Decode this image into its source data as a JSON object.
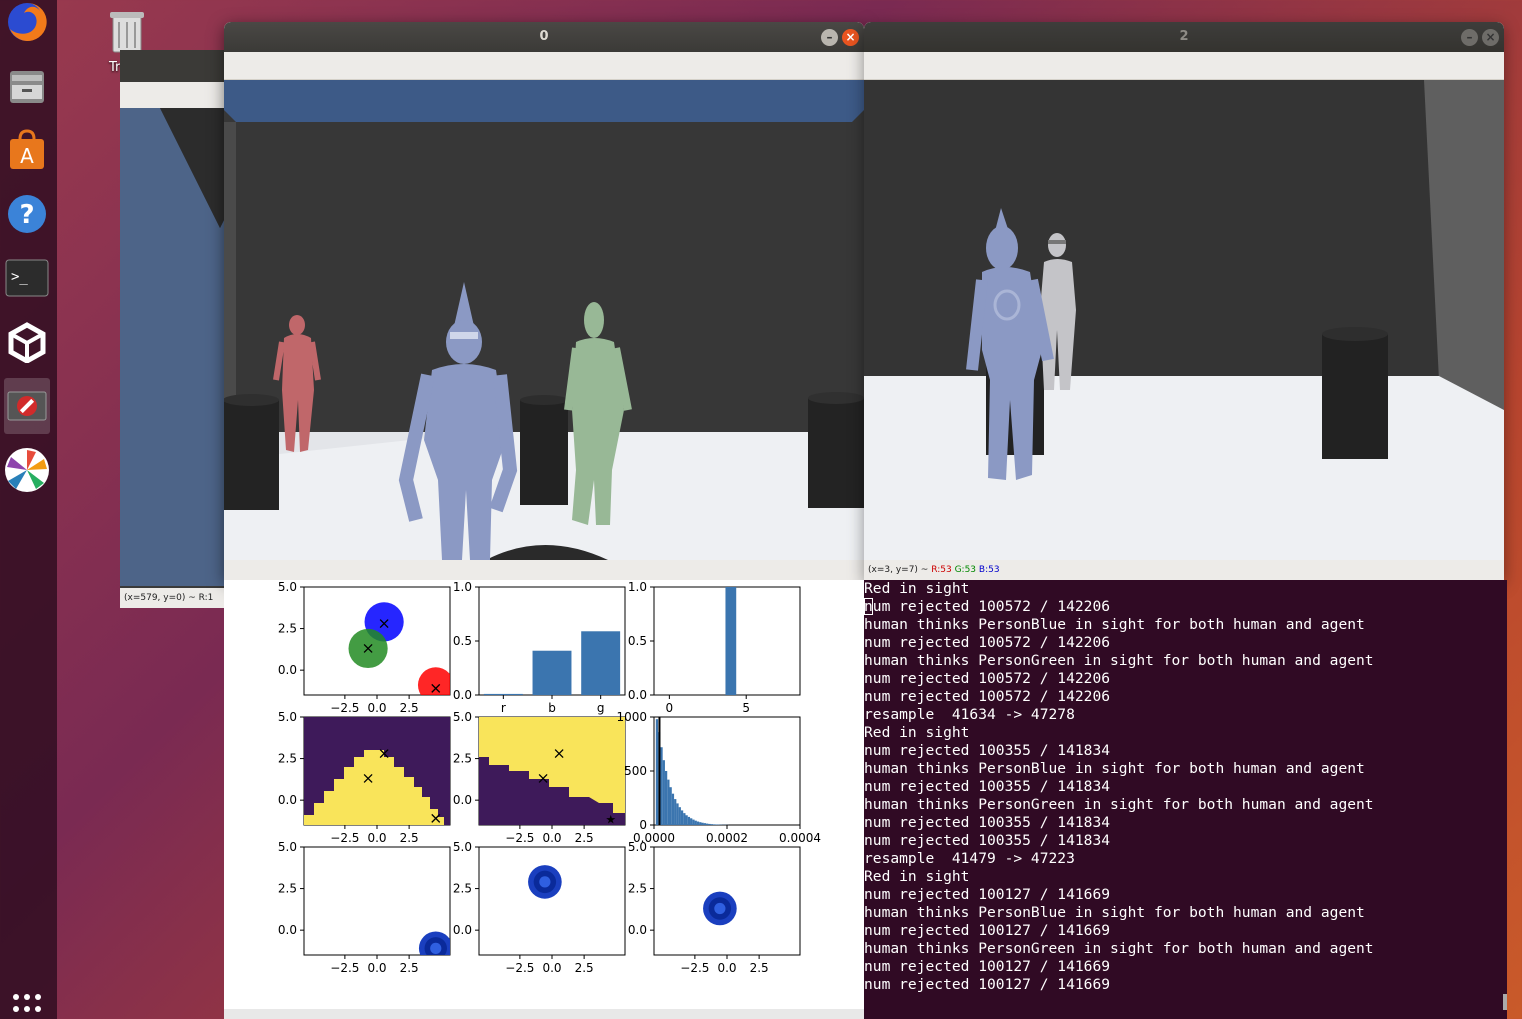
{
  "desktop": {
    "trash_label": "Tr"
  },
  "launcher": {
    "items": [
      {
        "name": "firefox-icon"
      },
      {
        "name": "files-icon"
      },
      {
        "name": "software-center-icon"
      },
      {
        "name": "help-icon"
      },
      {
        "name": "terminal-icon"
      },
      {
        "name": "unity-icon"
      },
      {
        "name": "blocked-app-icon"
      },
      {
        "name": "color-wheel-icon"
      },
      {
        "name": "show-apps-icon"
      }
    ]
  },
  "window_back": {
    "status": "(x=579, y=0) ~ R:1"
  },
  "window_0": {
    "title": "0"
  },
  "window_2": {
    "title": "2",
    "status_prefix": "(x=3, y=7) ~",
    "status_r": "R:53",
    "status_g": "G:53",
    "status_b": "B:53"
  },
  "colors": {
    "terminal_bg": "#300a24",
    "bar_color": "#3b75af",
    "viridis_low": "#3e1a5a",
    "viridis_high": "#f9e45a",
    "sky_blue": "#3d5a87"
  },
  "chart_data": [
    {
      "type": "scatter",
      "panel": "row1-col1",
      "ylim": [
        -1.5,
        5
      ],
      "xlim": [
        -4,
        4.2
      ],
      "yticks": [
        "5.0",
        "2.5",
        "0.0"
      ],
      "xticks": [
        "−2.5",
        "0.0",
        "2.5"
      ],
      "series": [
        {
          "color": "#0000ff",
          "center": [
            0.5,
            2.9
          ],
          "radius": 1.1
        },
        {
          "color": "#228b22",
          "center": [
            -0.4,
            1.3
          ],
          "radius": 1.1
        },
        {
          "color": "#ff0000",
          "center": [
            3.4,
            -0.9
          ],
          "radius": 1.0
        }
      ],
      "markers": [
        [
          0.5,
          2.8
        ],
        [
          -0.4,
          1.3
        ],
        [
          3.4,
          -1.1
        ]
      ]
    },
    {
      "type": "bar",
      "panel": "row1-col2",
      "categories": [
        "r",
        "b",
        "g"
      ],
      "values": [
        0.01,
        0.41,
        0.59
      ],
      "ylim": [
        0,
        1
      ],
      "yticks": [
        "1.0",
        "0.5",
        "0.0"
      ]
    },
    {
      "type": "bar",
      "panel": "row1-col3",
      "values": [
        1.0
      ],
      "x": [
        4
      ],
      "xlim": [
        -1,
        8.5
      ],
      "ylim": [
        0,
        1
      ],
      "yticks": [
        "1.0",
        "0.5",
        "0.0"
      ],
      "xticks": [
        "0",
        "5"
      ]
    },
    {
      "type": "heatmap",
      "panel": "row2-col1",
      "yticks": [
        "5.0",
        "2.5",
        "0.0"
      ],
      "xticks": [
        "−2.5",
        "0.0",
        "2.5"
      ],
      "markers": [
        [
          0.5,
          2.8
        ],
        [
          -0.4,
          1.3
        ],
        [
          3.4,
          -1.1
        ]
      ]
    },
    {
      "type": "heatmap",
      "panel": "row2-col2",
      "yticks": [
        "5.0",
        "2.5",
        "0.0"
      ],
      "xticks": [
        "−2.5",
        "0.0",
        "2.5"
      ],
      "markers": [
        [
          0.5,
          2.8
        ],
        [
          -0.4,
          1.3
        ]
      ],
      "star": [
        3.4,
        -1.1
      ]
    },
    {
      "type": "bar",
      "panel": "row2-col3",
      "xlim": [
        0,
        0.0004
      ],
      "ylim": [
        0,
        1000
      ],
      "yticks": [
        "1000",
        "500",
        "0"
      ],
      "xticks": [
        "0.0000",
        "0.0002",
        "0.0004"
      ],
      "values": [
        980,
        860,
        720,
        600,
        500,
        420,
        350,
        290,
        240,
        200,
        165,
        135,
        110,
        90,
        75,
        62,
        50,
        40,
        32,
        26,
        21,
        17,
        13,
        10,
        8,
        6,
        5,
        4,
        3,
        2,
        2,
        1
      ],
      "bin_width": 6.25e-06,
      "vline": 1.5e-05
    },
    {
      "type": "scatter",
      "panel": "row3-col1",
      "ylim": [
        -1.5,
        5
      ],
      "yticks": [
        "5.0",
        "2.5",
        "0.0"
      ],
      "xticks": [
        "−2.5",
        "0.0",
        "2.5"
      ],
      "cloud": {
        "center": [
          3.4,
          -1.1
        ],
        "radius": 0.9
      }
    },
    {
      "type": "scatter",
      "panel": "row3-col2",
      "ylim": [
        -1.5,
        5
      ],
      "yticks": [
        "5.0",
        "2.5",
        "0.0"
      ],
      "xticks": [
        "−2.5",
        "0.0",
        "2.5"
      ],
      "cloud": {
        "center": [
          -0.3,
          2.9
        ],
        "radius": 0.9
      }
    },
    {
      "type": "scatter",
      "panel": "row3-col3",
      "ylim": [
        -1.5,
        5
      ],
      "yticks": [
        "5.0",
        "2.5",
        "0.0"
      ],
      "xticks": [
        "−2.5",
        "0.0",
        "2.5"
      ],
      "cloud": {
        "center": [
          -0.3,
          1.3
        ],
        "radius": 0.9
      }
    }
  ],
  "terminal": {
    "lines": [
      "Red in sight",
      "num rejected 100572 / 142206",
      "human thinks PersonBlue in sight for both human and agent",
      "num rejected 100572 / 142206",
      "human thinks PersonGreen in sight for both human and agent",
      "num rejected 100572 / 142206",
      "num rejected 100572 / 142206",
      "resample  41634 -> 47278",
      "Red in sight",
      "num rejected 100355 / 141834",
      "human thinks PersonBlue in sight for both human and agent",
      "num rejected 100355 / 141834",
      "human thinks PersonGreen in sight for both human and agent",
      "num rejected 100355 / 141834",
      "num rejected 100355 / 141834",
      "resample  41479 -> 47223",
      "Red in sight",
      "num rejected 100127 / 141669",
      "human thinks PersonBlue in sight for both human and agent",
      "num rejected 100127 / 141669",
      "human thinks PersonGreen in sight for both human and agent",
      "num rejected 100127 / 141669",
      "num rejected 100127 / 141669"
    ]
  }
}
